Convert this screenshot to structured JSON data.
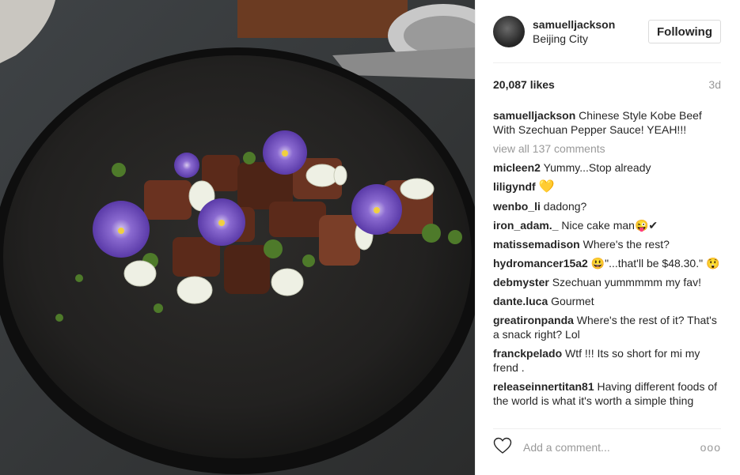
{
  "post": {
    "username": "samuelljackson",
    "location": "Beijing City",
    "follow_label": "Following",
    "likes": "20,087 likes",
    "age": "3d",
    "caption_user": "samuelljackson",
    "caption_text": "Chinese Style Kobe Beef With Szechuan Pepper Sauce! YEAH!!!",
    "view_all": "view all 137 comments",
    "comments": [
      {
        "user": "micleen2",
        "text": "Yummy...Stop already"
      },
      {
        "user": "liligyndf",
        "text": "💛"
      },
      {
        "user": "wenbo_li",
        "text": "dadong?"
      },
      {
        "user": "iron_adam._",
        "text": "Nice cake man😜✔"
      },
      {
        "user": "matissemadison",
        "text": "Where's the rest?"
      },
      {
        "user": "hydromancer15a2",
        "text": "😃\"...that'll be $48.30.\" 😲"
      },
      {
        "user": "debmyster",
        "text": "Szechuan yummmmm my fav!"
      },
      {
        "user": "dante.luca",
        "text": "Gourmet"
      },
      {
        "user": "greatironpanda",
        "text": "Where's the rest of it? That's a snack right? Lol"
      },
      {
        "user": "franckpelado",
        "text": "Wtf !!! Its so short for mi my frend ."
      },
      {
        "user": "releaseinnertitan81",
        "text": "Having different foods of the world is what it's worth a simple thing"
      }
    ],
    "add_comment_placeholder": "Add a comment...",
    "more_label": "ooo"
  },
  "icons": {
    "heart": "heart-outline-icon",
    "more": "more-options-icon"
  },
  "colors": {
    "muted": "#999999",
    "text": "#262626",
    "border": "#efefef"
  }
}
